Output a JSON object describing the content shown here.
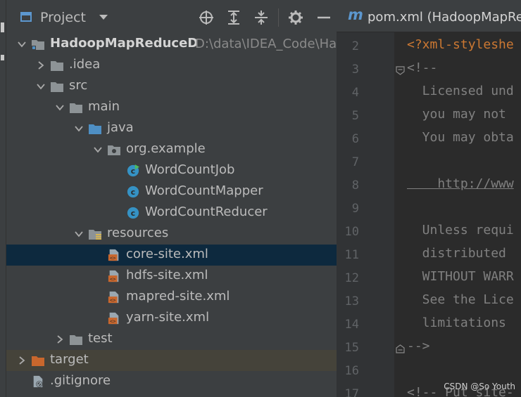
{
  "panel": {
    "title": "Project"
  },
  "tree": [
    {
      "label": "HadoopMapReduceD",
      "path": "D:\\data\\IDEA_Code\\Had",
      "icon": "module-folder-icon",
      "arrow": "down",
      "depth": 1,
      "bold": true
    },
    {
      "label": ".idea",
      "icon": "folder-icon",
      "arrow": "right",
      "depth": 2
    },
    {
      "label": "src",
      "icon": "folder-icon",
      "arrow": "down",
      "depth": 2
    },
    {
      "label": "main",
      "icon": "folder-icon",
      "arrow": "down",
      "depth": 3
    },
    {
      "label": "java",
      "icon": "source-folder-icon",
      "arrow": "down",
      "depth": 4
    },
    {
      "label": "org.example",
      "icon": "package-icon",
      "arrow": "down",
      "depth": 5
    },
    {
      "label": "WordCountJob",
      "icon": "class-runnable-icon",
      "depth": 6
    },
    {
      "label": "WordCountMapper",
      "icon": "class-icon",
      "depth": 6
    },
    {
      "label": "WordCountReducer",
      "icon": "class-icon",
      "depth": 6
    },
    {
      "label": "resources",
      "icon": "resources-folder-icon",
      "arrow": "down",
      "depth": 4
    },
    {
      "label": "core-site.xml",
      "icon": "xml-file-icon",
      "depth": 5,
      "selected": true
    },
    {
      "label": "hdfs-site.xml",
      "icon": "xml-file-icon",
      "depth": 5
    },
    {
      "label": "mapred-site.xml",
      "icon": "xml-file-icon",
      "depth": 5
    },
    {
      "label": "yarn-site.xml",
      "icon": "xml-file-icon",
      "depth": 5
    },
    {
      "label": "test",
      "icon": "folder-icon",
      "arrow": "right",
      "depth": 3
    },
    {
      "label": "target",
      "icon": "excluded-folder-icon",
      "arrow": "right",
      "depth": 1,
      "highlight": true
    },
    {
      "label": ".gitignore",
      "icon": "ignore-file-icon",
      "depth": 1
    }
  ],
  "editor": {
    "tab_label": "pom.xml (HadoopMapRe",
    "tab_icon": "maven-icon",
    "lines": [
      {
        "n": "2",
        "text": "<?xml-styleshe"
      },
      {
        "n": "3",
        "text": "<!--"
      },
      {
        "n": "4",
        "text": "  Licensed und"
      },
      {
        "n": "5",
        "text": "  you may not"
      },
      {
        "n": "6",
        "text": "  You may obta"
      },
      {
        "n": "7",
        "text": ""
      },
      {
        "n": "8",
        "text": "    http://www"
      },
      {
        "n": "9",
        "text": ""
      },
      {
        "n": "10",
        "text": "  Unless requi"
      },
      {
        "n": "11",
        "text": "  distributed"
      },
      {
        "n": "12",
        "text": "  WITHOUT WARR"
      },
      {
        "n": "13",
        "text": "  See the Lice"
      },
      {
        "n": "14",
        "text": "  limitations"
      },
      {
        "n": "15",
        "text": "-->"
      },
      {
        "n": "16",
        "text": ""
      },
      {
        "n": "17",
        "text": "<!-- Put site-"
      }
    ]
  },
  "watermark": "CSDN @So Youth",
  "colors": {
    "panel": "#3c3f41",
    "editor": "#2b2b2b",
    "selection": "#0d293e",
    "excluded_row": "#45433a",
    "comment": "#808080",
    "folder": "#8d9396",
    "source": "#4e8fc4",
    "excluded": "#c9672d"
  }
}
